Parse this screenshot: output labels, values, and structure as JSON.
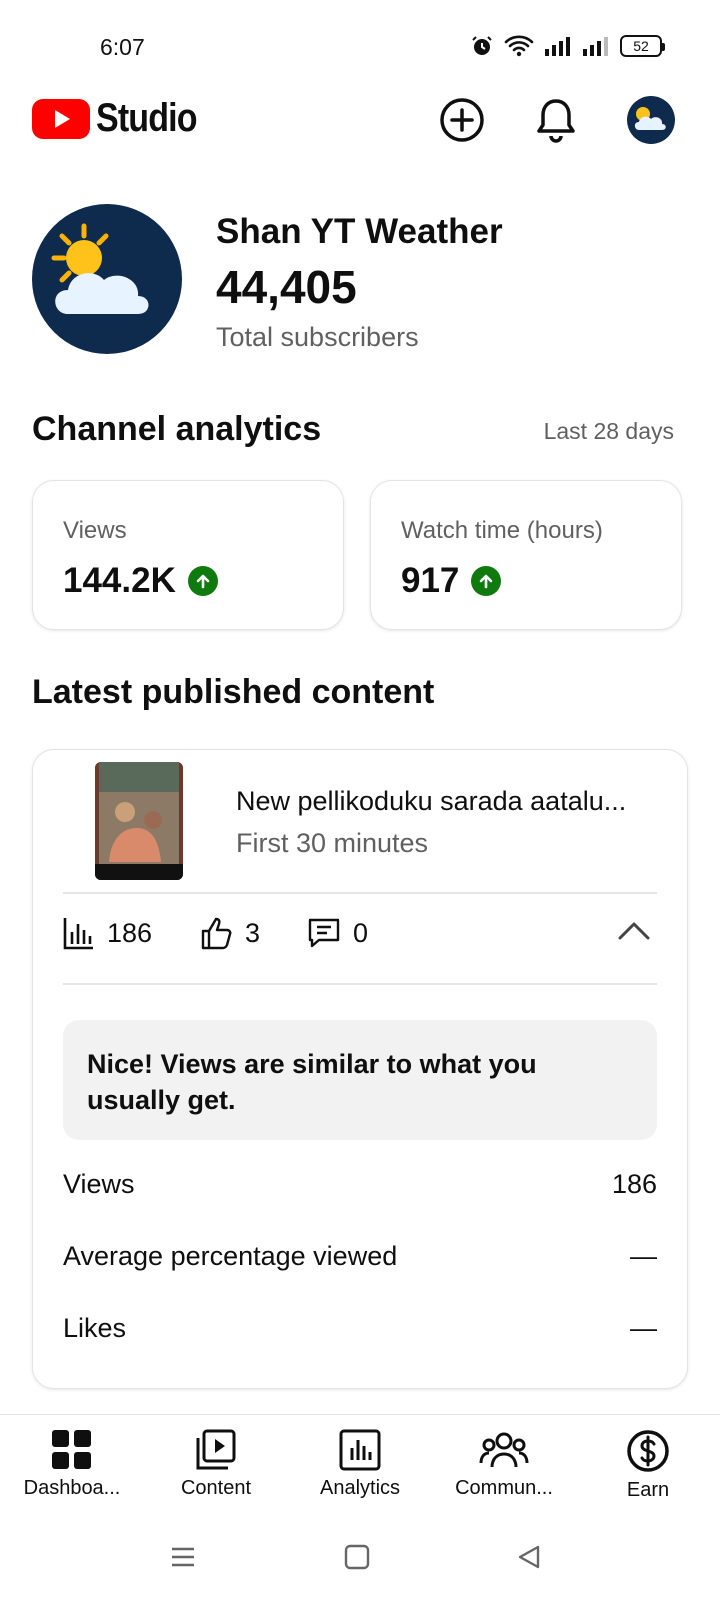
{
  "status_bar": {
    "time": "6:07",
    "battery": "52"
  },
  "app_bar": {
    "logo_text": "Studio",
    "brand_color": "#ff0000"
  },
  "channel": {
    "name": "Shan YT Weather",
    "subscriber_count": "44,405",
    "subscriber_label": "Total subscribers"
  },
  "analytics": {
    "title": "Channel analytics",
    "period": "Last 28 days",
    "cards": [
      {
        "label": "Views",
        "value": "144.2K",
        "trend": "up"
      },
      {
        "label": "Watch time (hours)",
        "value": "917",
        "trend": "up"
      }
    ],
    "trend_color": "#0f7b0f"
  },
  "latest": {
    "title": "Latest published content",
    "video_title": "New pellikoduku sarada aatalu...",
    "video_subtitle": "First 30 minutes",
    "metrics": {
      "views": "186",
      "likes": "3",
      "comments": "0"
    },
    "insight": "Nice! Views are similar to what you usually get.",
    "rows": [
      {
        "label": "Views",
        "value": "186"
      },
      {
        "label": "Average percentage viewed",
        "value": "—"
      },
      {
        "label": "Likes",
        "value": "—"
      }
    ]
  },
  "bottom_nav": {
    "items": [
      {
        "label": "Dashboa...",
        "icon": "dashboard-icon"
      },
      {
        "label": "Content",
        "icon": "content-icon"
      },
      {
        "label": "Analytics",
        "icon": "analytics-icon"
      },
      {
        "label": "Commun...",
        "icon": "community-icon"
      },
      {
        "label": "Earn",
        "icon": "earn-icon"
      }
    ]
  }
}
